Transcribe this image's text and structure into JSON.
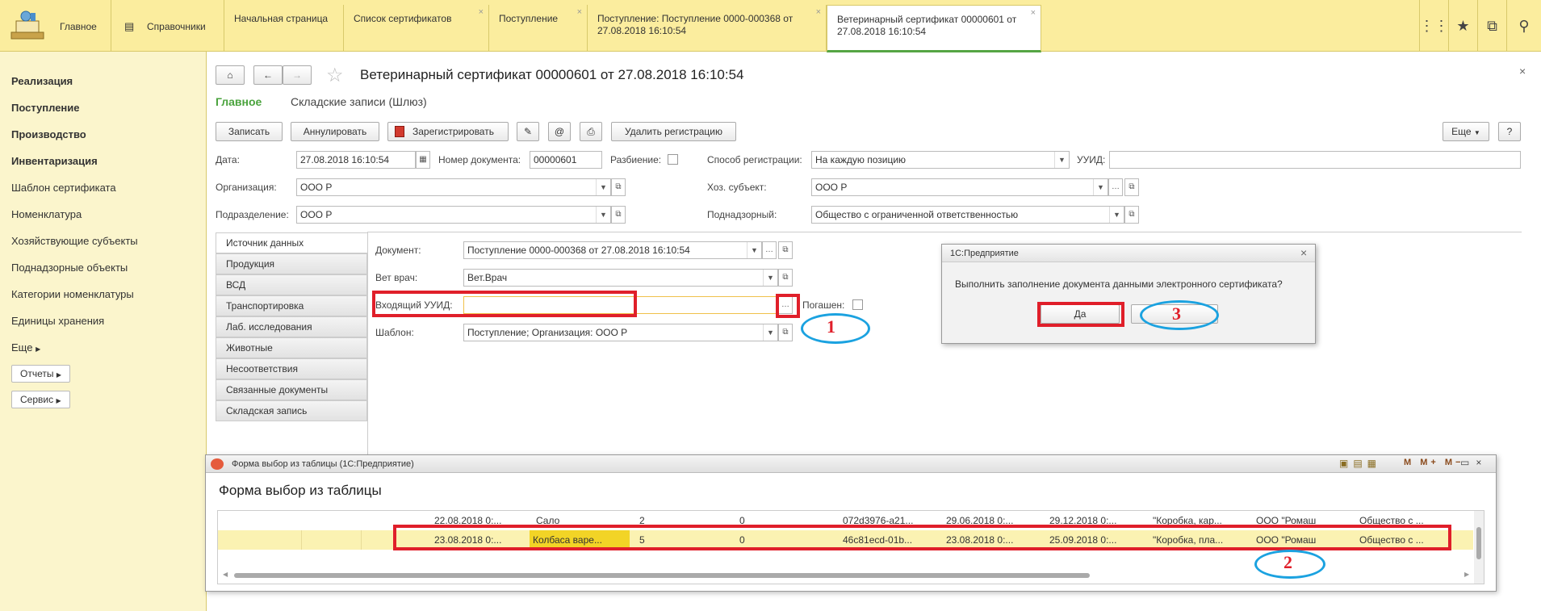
{
  "topbar": {
    "home_label": "Главное",
    "refs_label": "Справочники",
    "tabs": [
      {
        "label": "Начальная страница"
      },
      {
        "label": "Список сертификатов"
      },
      {
        "label": "Поступление"
      },
      {
        "label": "Поступление: Поступление 0000-000368 от 27.08.2018 16:10:54"
      },
      {
        "label": "Ветеринарный сертификат 00000601 от 27.08.2018 16:10:54"
      }
    ],
    "close_glyph": "×",
    "icons": [
      "grid-icon",
      "star-icon",
      "history-icon",
      "search-icon"
    ]
  },
  "sidebar": {
    "items": [
      {
        "label": "Реализация"
      },
      {
        "label": "Поступление"
      },
      {
        "label": "Производство"
      },
      {
        "label": "Инвентаризация"
      },
      {
        "label": "Шаблон сертификата"
      },
      {
        "label": "Номенклатура"
      },
      {
        "label": "Хозяйствующие субъекты"
      },
      {
        "label": "Поднадзорные объекты"
      },
      {
        "label": "Категории номенклатуры"
      },
      {
        "label": "Единицы хранения"
      },
      {
        "label": "Еще"
      }
    ],
    "reports_label": "Отчеты",
    "service_label": "Сервис"
  },
  "doc": {
    "title": "Ветеринарный сертификат 00000601 от 27.08.2018 16:10:54",
    "nav_main": "Главное",
    "nav_store": "Складские записи (Шлюз)",
    "close_glyph": "×",
    "toolbar": {
      "save": "Записать",
      "cancel": "Аннулировать",
      "register": "Зарегистрировать",
      "email": "@",
      "delete_reg": "Удалить регистрацию",
      "more": "Еще",
      "help": "?"
    },
    "fields": {
      "date_label": "Дата:",
      "date_value": "27.08.2018 16:10:54",
      "docnum_label": "Номер документа:",
      "docnum_value": "00000601",
      "split_label": "Разбиение:",
      "regway_label": "Способ регистрации:",
      "regway_value": "На каждую позицию",
      "uuid_label": "УУИД:",
      "uuid_value": "",
      "org_label": "Организация:",
      "org_value": "ООО Р",
      "hoz_label": "Хоз. субъект:",
      "hoz_value": "ООО  Р",
      "dept_label": "Подразделение:",
      "dept_value": "ООО Р",
      "supervised_label": "Поднадзорный:",
      "supervised_value": "Общество с ограниченной ответственностью"
    },
    "vtabs": [
      {
        "label": "Источник данных"
      },
      {
        "label": "Продукция"
      },
      {
        "label": "ВСД"
      },
      {
        "label": "Транспортировка"
      },
      {
        "label": "Лаб. исследования"
      },
      {
        "label": "Животные"
      },
      {
        "label": "Несоответствия"
      },
      {
        "label": "Связанные документы"
      },
      {
        "label": "Складская запись"
      }
    ],
    "source": {
      "document_label": "Документ:",
      "document_value": "Поступление 0000-000368 от 27.08.2018 16:10:54",
      "vet_label": "Вет врач:",
      "vet_value": "Вет.Врач",
      "incoming_label": "Входящий УУИД:",
      "incoming_value": "",
      "paid_label": "Погашен:",
      "template_label": "Шаблон:",
      "template_value": "Поступление; Организация: ООО Р"
    }
  },
  "markers": {
    "m1": "1",
    "m2": "2",
    "m3": "3"
  },
  "dialog": {
    "title": "1С:Предприятие",
    "message": "Выполнить заполнение документа данными электронного сертификата?",
    "yes": "Да",
    "no": ""
  },
  "pick_window": {
    "titlebar": "Форма выбор из таблицы  (1С:Предприятие)",
    "heading": "Форма выбор из таблицы",
    "rows": [
      [
        "",
        "",
        "22.08.2018 0:...",
        "Сало",
        "2",
        "0",
        "072d3976-a21...",
        "29.06.2018 0:...",
        "29.12.2018 0:...",
        "\"Коробка, кар...",
        "ООО \"Ромаш",
        "Общество с ..."
      ],
      [
        "",
        "",
        "23.08.2018 0:...",
        "Колбаса варе...",
        "5",
        "0",
        "46c81ecd-01b...",
        "23.08.2018 0:...",
        "25.09.2018 0:...",
        "\"Коробка, пла...",
        "ООО \"Ромаш",
        "Общество с ..."
      ]
    ]
  },
  "colors": {
    "accent_red": "#e01f2a",
    "accent_blue": "#1ba2e0",
    "tab_bar": "#fbed9e",
    "sidebar": "#fbf5cc",
    "active_green": "#55a544"
  }
}
